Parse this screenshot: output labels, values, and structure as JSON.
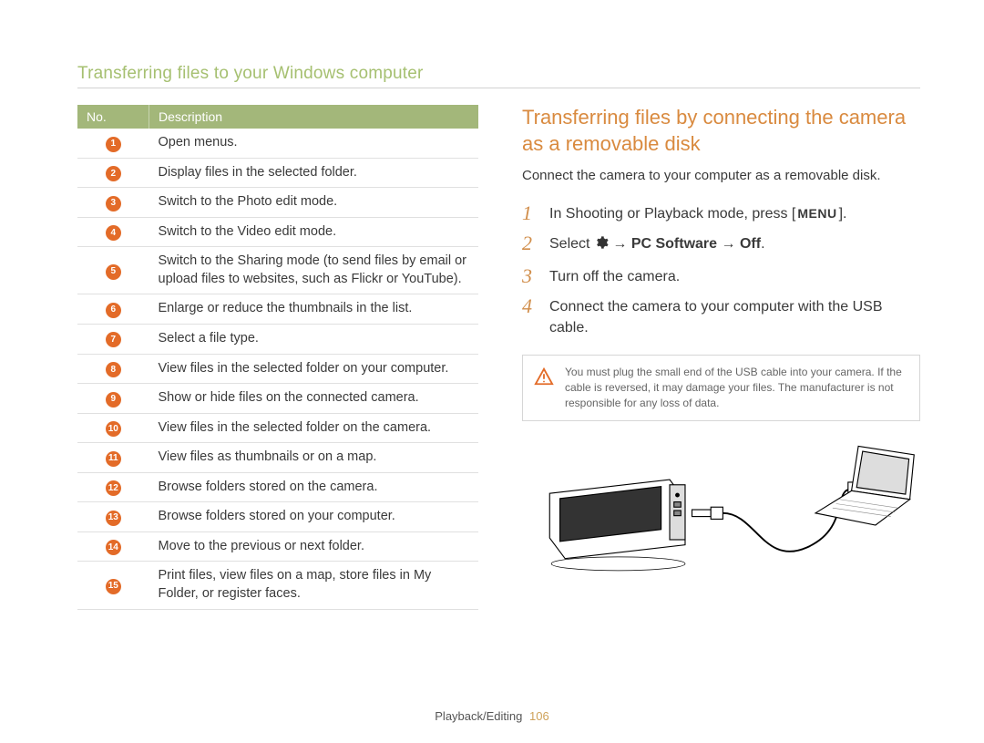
{
  "page_title": "Transferring files to your Windows computer",
  "table": {
    "header_no": "No.",
    "header_desc": "Description",
    "rows": [
      {
        "num": "1",
        "desc": "Open menus."
      },
      {
        "num": "2",
        "desc": "Display files in the selected folder."
      },
      {
        "num": "3",
        "desc": "Switch to the Photo edit mode."
      },
      {
        "num": "4",
        "desc": "Switch to the Video edit mode."
      },
      {
        "num": "5",
        "desc": "Switch to the Sharing mode (to send files by email or upload files to websites, such as Flickr or YouTube)."
      },
      {
        "num": "6",
        "desc": "Enlarge or reduce the thumbnails in the list."
      },
      {
        "num": "7",
        "desc": "Select a file type."
      },
      {
        "num": "8",
        "desc": "View files in the selected folder on your computer."
      },
      {
        "num": "9",
        "desc": "Show or hide files on the connected camera."
      },
      {
        "num": "10",
        "desc": "View files in the selected folder on the camera."
      },
      {
        "num": "11",
        "desc": "View files as thumbnails or on a map."
      },
      {
        "num": "12",
        "desc": "Browse folders stored on the camera."
      },
      {
        "num": "13",
        "desc": "Browse folders stored on your computer."
      },
      {
        "num": "14",
        "desc": "Move to the previous or next folder."
      },
      {
        "num": "15",
        "desc": "Print files, view files on a map, store files in My Folder, or register faces."
      }
    ]
  },
  "section_heading": "Transferring files by connecting the camera as a removable disk",
  "intro": "Connect the camera to your computer as a removable disk.",
  "steps": {
    "s1_a": "In Shooting or Playback mode, press [",
    "s1_menu": "MENU",
    "s1_b": "].",
    "s2_a": "Select ",
    "s2_gear": "gear-icon",
    "s2_b": " → ",
    "s2_c": "PC Software",
    "s2_d": " → ",
    "s2_e": "Off",
    "s2_f": ".",
    "s3": "Turn off the camera.",
    "s4": "Connect the camera to your computer with the USB cable."
  },
  "note": "You must plug the small end of the USB cable into your camera. If the cable is reversed, it may damage your files. The manufacturer is not responsible for any loss of data.",
  "footer_section": "Playback/Editing",
  "footer_page": "106"
}
